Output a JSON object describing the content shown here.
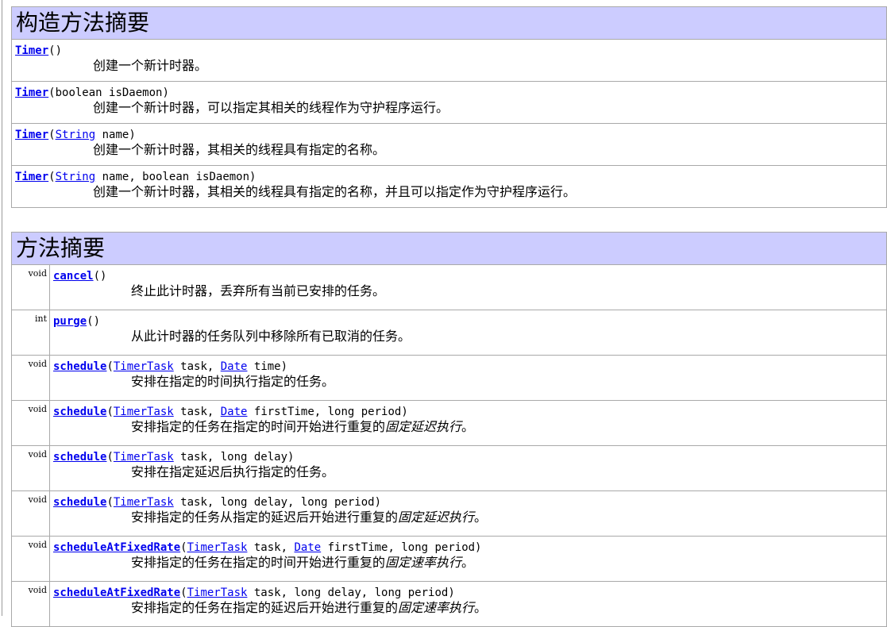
{
  "constructors": {
    "title": "构造方法摘要",
    "rows": [
      {
        "name": "Timer",
        "open": "()",
        "p1": "",
        "p1link": "",
        "p2": "",
        "desc": "创建一个新计时器。"
      },
      {
        "name": "Timer",
        "open": "(boolean isDaemon)",
        "p1": "",
        "p1link": "",
        "p2": "",
        "desc": "创建一个新计时器，可以指定其相关的线程作为守护程序运行。"
      },
      {
        "name": "Timer",
        "open": "(",
        "p1link": "String",
        "p1": " name)",
        "p2": "",
        "desc": "创建一个新计时器，其相关的线程具有指定的名称。"
      },
      {
        "name": "Timer",
        "open": "(",
        "p1link": "String",
        "p1": " name, boolean isDaemon)",
        "p2": "",
        "desc": "创建一个新计时器，其相关的线程具有指定的名称，并且可以指定作为守护程序运行。"
      }
    ]
  },
  "methods": {
    "title": "方法摘要",
    "rows": [
      {
        "type": "void",
        "name": "cancel",
        "s1": "()",
        "l1": "",
        "s2": "",
        "l2": "",
        "s3": "",
        "desc": "终止此计时器，丢弃所有当前已安排的任务。",
        "emph": ""
      },
      {
        "type": "int",
        "name": "purge",
        "s1": "()",
        "l1": "",
        "s2": "",
        "l2": "",
        "s3": "",
        "desc": "从此计时器的任务队列中移除所有已取消的任务。",
        "emph": ""
      },
      {
        "type": "void",
        "name": "schedule",
        "s1": "(",
        "l1": "TimerTask",
        "s2": " task, ",
        "l2": "Date",
        "s3": " time)",
        "desc": "安排在指定的时间执行指定的任务。",
        "emph": ""
      },
      {
        "type": "void",
        "name": "schedule",
        "s1": "(",
        "l1": "TimerTask",
        "s2": " task, ",
        "l2": "Date",
        "s3": " firstTime, long period)",
        "desc": "安排指定的任务在指定的时间开始进行重复的",
        "emph": "固定延迟执行",
        "end": "。"
      },
      {
        "type": "void",
        "name": "schedule",
        "s1": "(",
        "l1": "TimerTask",
        "s2": " task, long delay)",
        "l2": "",
        "s3": "",
        "desc": "安排在指定延迟后执行指定的任务。",
        "emph": ""
      },
      {
        "type": "void",
        "name": "schedule",
        "s1": "(",
        "l1": "TimerTask",
        "s2": " task, long delay, long period)",
        "l2": "",
        "s3": "",
        "desc": "安排指定的任务从指定的延迟后开始进行重复的",
        "emph": "固定延迟执行",
        "end": "。"
      },
      {
        "type": "void",
        "name": "scheduleAtFixedRate",
        "s1": "(",
        "l1": "TimerTask",
        "s2": " task, ",
        "l2": "Date",
        "s3": " firstTime, long period)",
        "desc": "安排指定的任务在指定的时间开始进行重复的",
        "emph": "固定速率执行",
        "end": "。"
      },
      {
        "type": "void",
        "name": "scheduleAtFixedRate",
        "s1": "(",
        "l1": "TimerTask",
        "s2": " task, long delay, long period)",
        "l2": "",
        "s3": "",
        "desc": "安排指定的任务在指定的延迟后开始进行重复的",
        "emph": "固定速率执行",
        "end": "。"
      }
    ]
  }
}
